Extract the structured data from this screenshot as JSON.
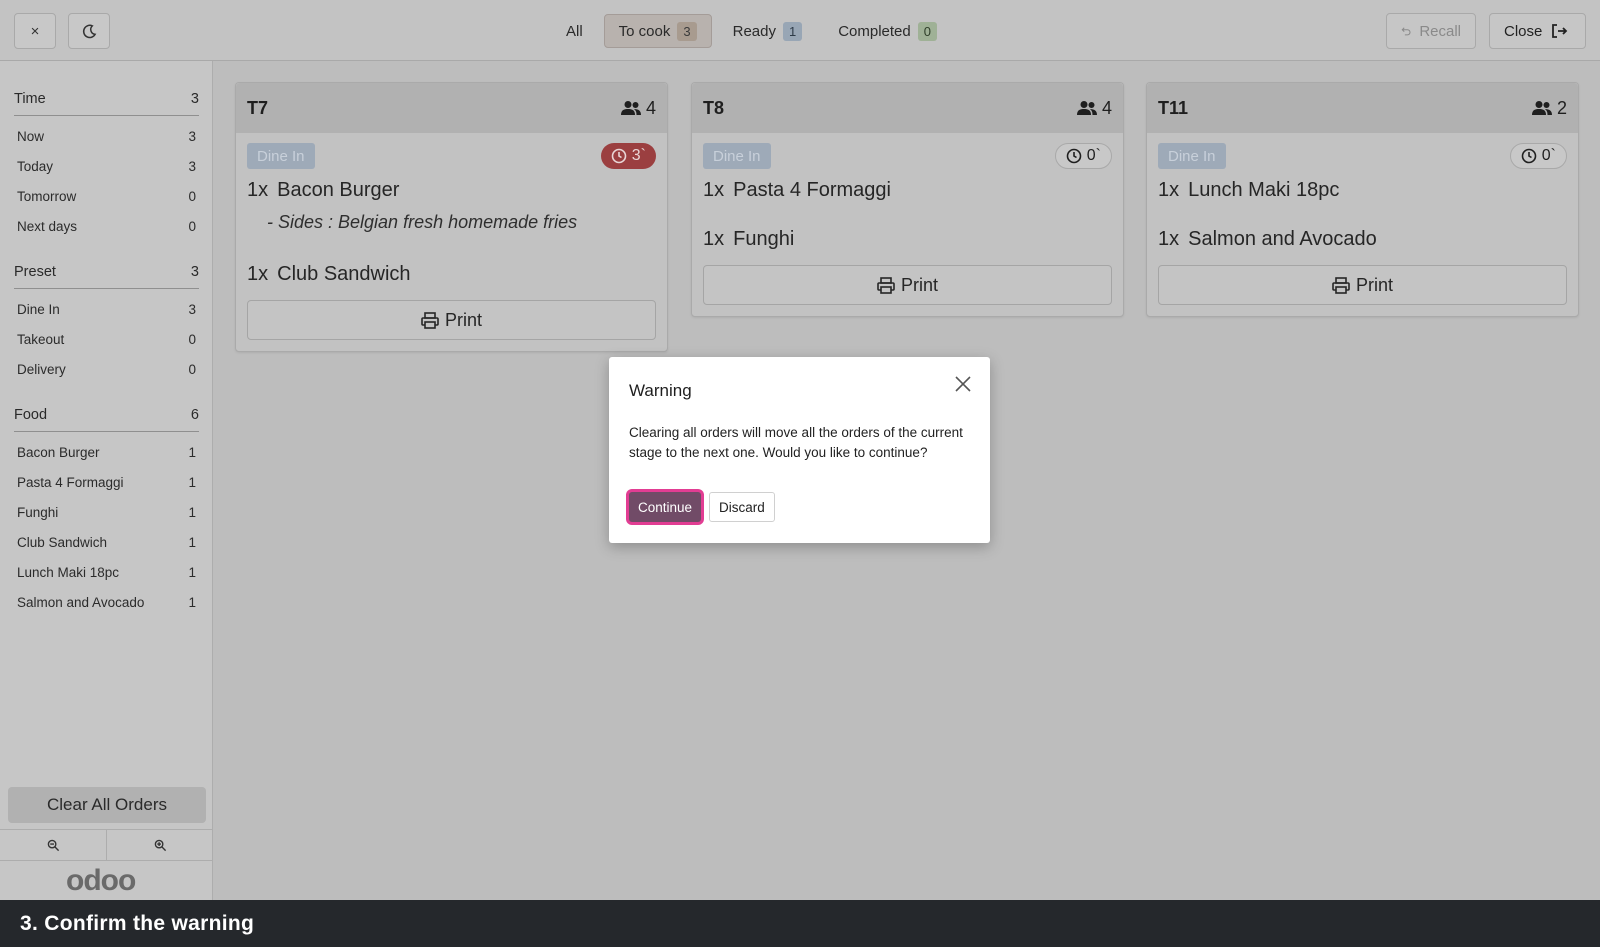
{
  "topbar": {
    "tabs": [
      {
        "label": "All",
        "count": ""
      },
      {
        "label": "To cook",
        "count": "3"
      },
      {
        "label": "Ready",
        "count": "1"
      },
      {
        "label": "Completed",
        "count": "0"
      }
    ],
    "recall_label": "Recall",
    "close_label": "Close",
    "close_x": "×"
  },
  "sidebar": {
    "time": {
      "label": "Time",
      "count": "3",
      "items": [
        {
          "label": "Now",
          "count": "3"
        },
        {
          "label": "Today",
          "count": "3"
        },
        {
          "label": "Tomorrow",
          "count": "0"
        },
        {
          "label": "Next days",
          "count": "0"
        }
      ]
    },
    "preset": {
      "label": "Preset",
      "count": "3",
      "items": [
        {
          "label": "Dine In",
          "count": "3"
        },
        {
          "label": "Takeout",
          "count": "0"
        },
        {
          "label": "Delivery",
          "count": "0"
        }
      ]
    },
    "food": {
      "label": "Food",
      "count": "6",
      "items": [
        {
          "label": "Bacon Burger",
          "count": "1"
        },
        {
          "label": "Pasta 4 Formaggi",
          "count": "1"
        },
        {
          "label": "Funghi",
          "count": "1"
        },
        {
          "label": "Club Sandwich",
          "count": "1"
        },
        {
          "label": "Lunch Maki 18pc",
          "count": "1"
        },
        {
          "label": "Salmon and Avocado",
          "count": "1"
        }
      ]
    },
    "clear_all_label": "Clear All Orders",
    "logo_text": "odoo"
  },
  "orders": [
    {
      "table": "T7",
      "guests": "4",
      "preset": "Dine In",
      "timer": "3`",
      "lines": [
        {
          "qty": "1x",
          "name": "Bacon Burger"
        },
        {
          "qty": "1x",
          "name": "Club Sandwich"
        }
      ],
      "modifier": "- Sides : Belgian fresh homemade fries",
      "print_label": "Print"
    },
    {
      "table": "T8",
      "guests": "4",
      "preset": "Dine In",
      "timer": "0`",
      "lines": [
        {
          "qty": "1x",
          "name": "Pasta 4 Formaggi"
        },
        {
          "qty": "1x",
          "name": "Funghi"
        }
      ],
      "print_label": "Print"
    },
    {
      "table": "T11",
      "guests": "2",
      "preset": "Dine In",
      "timer": "0`",
      "lines": [
        {
          "qty": "1x",
          "name": "Lunch Maki 18pc"
        },
        {
          "qty": "1x",
          "name": "Salmon and Avocado"
        }
      ],
      "print_label": "Print"
    }
  ],
  "dialog": {
    "title": "Warning",
    "body": "Clearing all orders will move all the orders of the current stage to the next one. Would you like to continue?",
    "continue_label": "Continue",
    "discard_label": "Discard"
  },
  "caption": "3. Confirm the warning",
  "colors": {
    "primary": "#714b67",
    "focus_ring": "#e23d93",
    "late_timer": "#9b3f40"
  }
}
